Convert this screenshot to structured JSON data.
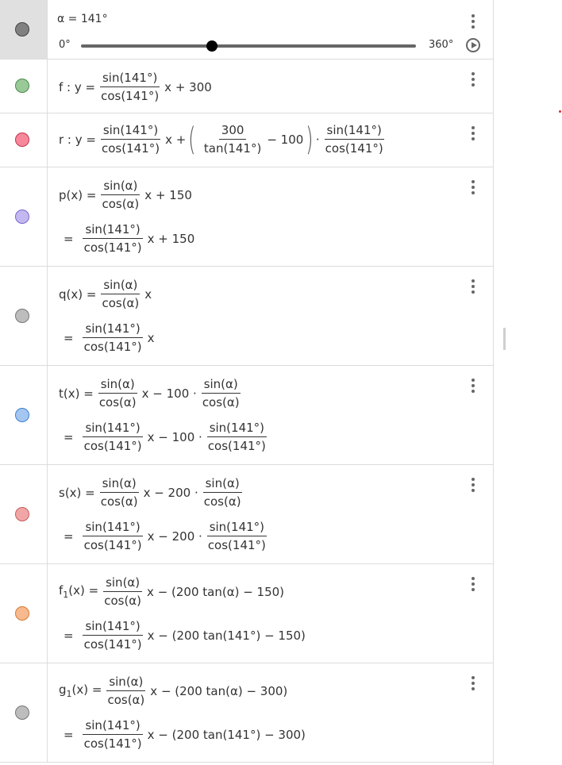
{
  "slider": {
    "label": "α = 141°",
    "min_label": "0°",
    "max_label": "360°",
    "value_fraction": 0.3917,
    "marble_color": "#808080"
  },
  "rows": {
    "f": {
      "color": "#99c999",
      "lhs": "f : y =",
      "num": "sin(141°)",
      "den": "cos(141°)",
      "tail": "x + 300"
    },
    "r": {
      "color": "#f7889b",
      "lhs": "r : y =",
      "num": "sin(141°)",
      "den": "cos(141°)",
      "mid": "x +",
      "inner_num": "300",
      "inner_den": "tan(141°)",
      "inner_tail": "− 100",
      "dot": "·",
      "num2": "sin(141°)",
      "den2": "cos(141°)"
    },
    "p": {
      "color": "#c4b8f0",
      "lhs": "p(x) =",
      "num": "sin(α)",
      "den": "cos(α)",
      "tail": "x + 150",
      "eq": "=",
      "vnum": "sin(141°)",
      "vden": "cos(141°)",
      "vtail": "x + 150"
    },
    "q": {
      "color": "#bdbdbd",
      "lhs": "q(x) =",
      "num": "sin(α)",
      "den": "cos(α)",
      "tail": "x",
      "eq": "=",
      "vnum": "sin(141°)",
      "vden": "cos(141°)",
      "vtail": "x"
    },
    "t": {
      "color": "#a4c6f0",
      "lhs": "t(x) =",
      "num": "sin(α)",
      "den": "cos(α)",
      "tail": "x − 100 ·",
      "num2": "sin(α)",
      "den2": "cos(α)",
      "eq": "=",
      "vnum": "sin(141°)",
      "vden": "cos(141°)",
      "vtail": "x − 100 ·",
      "vnum2": "sin(141°)",
      "vden2": "cos(141°)"
    },
    "s": {
      "color": "#f0a6a6",
      "lhs": "s(x) =",
      "num": "sin(α)",
      "den": "cos(α)",
      "tail": "x − 200 ·",
      "num2": "sin(α)",
      "den2": "cos(α)",
      "eq": "=",
      "vnum": "sin(141°)",
      "vden": "cos(141°)",
      "vtail": "x − 200 ·",
      "vnum2": "sin(141°)",
      "vden2": "cos(141°)"
    },
    "f1": {
      "color": "#f7b98e",
      "lhs_name": "f",
      "lhs_sub": "1",
      "lhs_rest": "(x) =",
      "num": "sin(α)",
      "den": "cos(α)",
      "tail": "x − (200  tan(α) − 150)",
      "eq": "=",
      "vnum": "sin(141°)",
      "vden": "cos(141°)",
      "vtail": "x − (200  tan(141°) − 150)"
    },
    "g1": {
      "color": "#bdbdbd",
      "lhs_name": "g",
      "lhs_sub": "1",
      "lhs_rest": "(x) =",
      "num": "sin(α)",
      "den": "cos(α)",
      "tail": "x − (200  tan(α) − 300)",
      "eq": "=",
      "vnum": "sin(141°)",
      "vden": "cos(141°)",
      "vtail": "x − (200  tan(141°) − 300)"
    }
  }
}
